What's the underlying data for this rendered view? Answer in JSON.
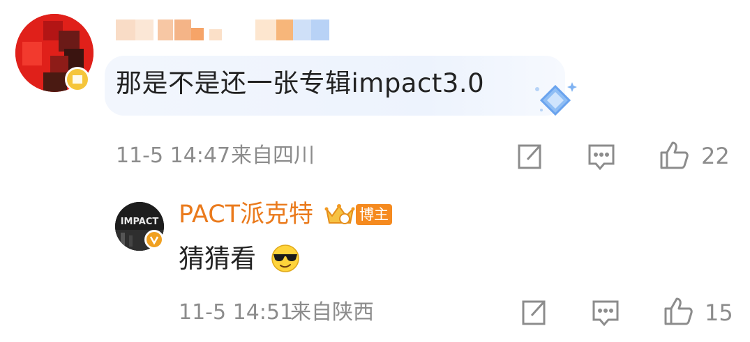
{
  "comment": {
    "text": "那是不是还一张专辑impact3.0",
    "time": "11-5 14:47",
    "location": "来自四川",
    "likes": "22"
  },
  "reply": {
    "author": "PACT派克特",
    "badge": "博主",
    "text": "猜猜看",
    "time": "11-5 14:51",
    "location": "来自陕西",
    "likes": "15",
    "avatar_text": "IMPACT"
  },
  "icons": {
    "share": "share-icon",
    "comment": "comment-icon",
    "like": "thumbs-up-icon",
    "emoji": "cool-sunglasses-emoji"
  },
  "colors": {
    "name_orange": "#ea7a1c",
    "meta_gray": "#8c8c8c",
    "bubble_blue": "#eef4fd"
  }
}
